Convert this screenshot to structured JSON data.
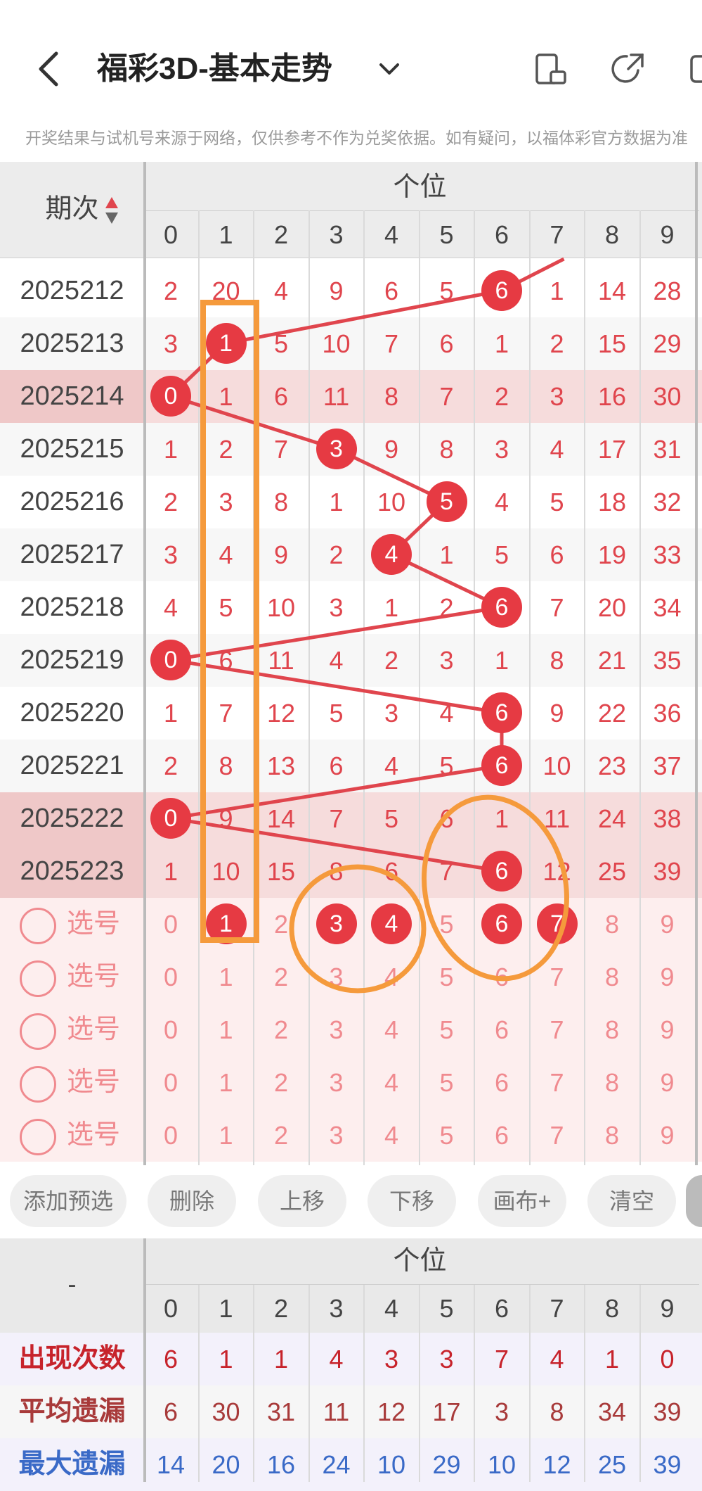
{
  "header": {
    "title": "福彩3D-基本走势",
    "disclaimer": "开奖结果与试机号来源于网络，仅供参考不作为兑奖依据。如有疑问，以福体彩官方数据为准",
    "icons": [
      "back-icon",
      "chevron-down-icon",
      "portrait-phone-icon",
      "share-icon",
      "menu-icon"
    ]
  },
  "grid": {
    "issue_header": "期次",
    "group_header": "个位",
    "digits": [
      "0",
      "1",
      "2",
      "3",
      "4",
      "5",
      "6",
      "7",
      "8",
      "9"
    ],
    "rows": [
      {
        "issue": "2025212",
        "cells": [
          "2",
          "20",
          "4",
          "9",
          "6",
          "5",
          "6",
          "1",
          "14",
          "28"
        ],
        "hit": 6
      },
      {
        "issue": "2025213",
        "cells": [
          "3",
          "1",
          "5",
          "10",
          "7",
          "6",
          "1",
          "2",
          "15",
          "29"
        ],
        "hit": 1
      },
      {
        "issue": "2025214",
        "cells": [
          "0",
          "1",
          "6",
          "11",
          "8",
          "7",
          "2",
          "3",
          "16",
          "30"
        ],
        "hit": 0
      },
      {
        "issue": "2025215",
        "cells": [
          "1",
          "2",
          "7",
          "3",
          "9",
          "8",
          "3",
          "4",
          "17",
          "31"
        ],
        "hit": 3
      },
      {
        "issue": "2025216",
        "cells": [
          "2",
          "3",
          "8",
          "1",
          "10",
          "5",
          "4",
          "5",
          "18",
          "32"
        ],
        "hit": 5
      },
      {
        "issue": "2025217",
        "cells": [
          "3",
          "4",
          "9",
          "2",
          "4",
          "1",
          "5",
          "6",
          "19",
          "33"
        ],
        "hit": 4
      },
      {
        "issue": "2025218",
        "cells": [
          "4",
          "5",
          "10",
          "3",
          "1",
          "2",
          "6",
          "7",
          "20",
          "34"
        ],
        "hit": 6
      },
      {
        "issue": "2025219",
        "cells": [
          "0",
          "6",
          "11",
          "4",
          "2",
          "3",
          "1",
          "8",
          "21",
          "35"
        ],
        "hit": 0
      },
      {
        "issue": "2025220",
        "cells": [
          "1",
          "7",
          "12",
          "5",
          "3",
          "4",
          "6",
          "9",
          "22",
          "36"
        ],
        "hit": 6
      },
      {
        "issue": "2025221",
        "cells": [
          "2",
          "8",
          "13",
          "6",
          "4",
          "5",
          "6",
          "10",
          "23",
          "37"
        ],
        "hit": 6
      },
      {
        "issue": "2025222",
        "cells": [
          "0",
          "9",
          "14",
          "7",
          "5",
          "6",
          "1",
          "11",
          "24",
          "38"
        ],
        "hit": 0
      },
      {
        "issue": "2025223",
        "cells": [
          "1",
          "10",
          "15",
          "8",
          "6",
          "7",
          "6",
          "12",
          "25",
          "39"
        ],
        "hit": 6
      }
    ],
    "select_label": "选号",
    "select_rows": [
      {
        "selected": [
          1,
          3,
          4,
          6,
          7
        ]
      },
      {
        "selected": []
      },
      {
        "selected": []
      },
      {
        "selected": []
      },
      {
        "selected": []
      }
    ]
  },
  "buttons": [
    "添加预选",
    "删除",
    "上移",
    "下移",
    "画布+",
    "清空"
  ],
  "stats": {
    "corner": "-",
    "group_header": "个位",
    "digits": [
      "0",
      "1",
      "2",
      "3",
      "4",
      "5",
      "6",
      "7",
      "8",
      "9"
    ],
    "rows": [
      {
        "label": "出现次数",
        "values": [
          "6",
          "1",
          "1",
          "4",
          "3",
          "3",
          "7",
          "4",
          "1",
          "0"
        ],
        "color": "#c7232b"
      },
      {
        "label": "平均遗漏",
        "values": [
          "6",
          "30",
          "31",
          "11",
          "12",
          "17",
          "3",
          "8",
          "34",
          "39"
        ],
        "color": "#a83a3a"
      },
      {
        "label": "最大遗漏",
        "values": [
          "14",
          "20",
          "16",
          "24",
          "10",
          "29",
          "10",
          "12",
          "25",
          "39"
        ],
        "color": "#3a6ac7"
      }
    ]
  },
  "colors": {
    "accent": "#e63a43",
    "highlight_row": "#f6dcdc",
    "select_bg": "#fdeeee",
    "annotation": "#f59a3c"
  }
}
